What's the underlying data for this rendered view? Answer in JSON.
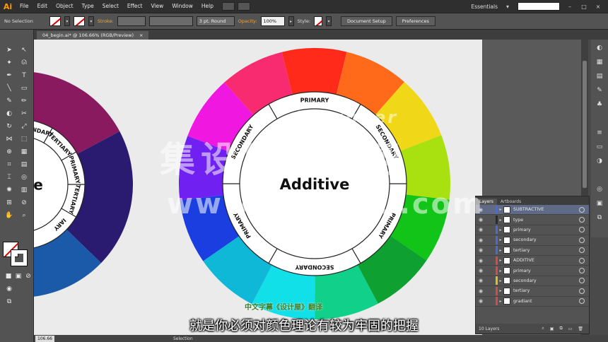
{
  "app": {
    "logo": "Ai"
  },
  "menu": [
    "File",
    "Edit",
    "Object",
    "Type",
    "Select",
    "Effect",
    "View",
    "Window",
    "Help"
  ],
  "workspace": "Essentials",
  "window_controls": [
    "–",
    "□",
    "×"
  ],
  "control_bar": {
    "selection": "No Selection",
    "stroke_label": "Stroke:",
    "brush": "3 pt. Round",
    "opacity_label": "Opacity:",
    "opacity_value": "100%",
    "style_label": "Style:",
    "document_setup": "Document Setup",
    "preferences": "Preferences"
  },
  "document_tab": {
    "title": "04_begin.ai* @ 106.66% (RGB/Preview)",
    "close": "×"
  },
  "status": {
    "zoom": "106.66",
    "tool": "Selection"
  },
  "layers_panel": {
    "tabs": [
      "Layers",
      "Artboards"
    ],
    "rows": [
      {
        "name": "SUBTRACTIVE",
        "color": "#4a6bd8",
        "selected": true
      },
      {
        "name": "type",
        "color": "#2a2a2a",
        "selected": false
      },
      {
        "name": "primary",
        "color": "#4a6bd8",
        "selected": false
      },
      {
        "name": "secondary",
        "color": "#4a6bd8",
        "selected": false
      },
      {
        "name": "tertiary",
        "color": "#4a6bd8",
        "selected": false
      },
      {
        "name": "ADDITIVE",
        "color": "#d84a4a",
        "selected": false
      },
      {
        "name": "primary",
        "color": "#d84a4a",
        "selected": false
      },
      {
        "name": "secondary",
        "color": "#e0c020",
        "selected": false
      },
      {
        "name": "tertiary",
        "color": "#d84a4a",
        "selected": false
      },
      {
        "name": "gradiant",
        "color": "#d84a4a",
        "selected": false
      }
    ],
    "count": "10 Layers"
  },
  "artwork": {
    "main_wheel": {
      "title": "Additive",
      "labels": [
        "PRIMARY",
        "SECONDARY",
        "PRIMARY",
        "SECONDARY",
        "PRIMARY",
        "SECONDARY"
      ],
      "colors": [
        "#ff2a1a",
        "#ff6a1a",
        "#f0d818",
        "#a8e010",
        "#12c418",
        "#0ea030",
        "#11d08a",
        "#12e0e8",
        "#10b8d8",
        "#1a3ee0",
        "#7020f0",
        "#f018e0",
        "#f82a70"
      ]
    },
    "left_wheel": {
      "title": "e",
      "labels": [
        "SECONDARY",
        "TERTIARY",
        "PRIMARY",
        "TERTIARY",
        "IARY"
      ],
      "colors": [
        "#8a1a60",
        "#2a1a70",
        "#1a5aa8",
        "#1a8ad0",
        "#1aa8b8"
      ]
    }
  },
  "overlay": {
    "watermark": "集设屋设计网",
    "watermark_url": "www.jishewu.com",
    "watermark_designer": "Designer",
    "credit": "中文字幕《设计屋》翻译",
    "subtitle": "就是你必须对颜色理论有较为牢固的把握"
  }
}
